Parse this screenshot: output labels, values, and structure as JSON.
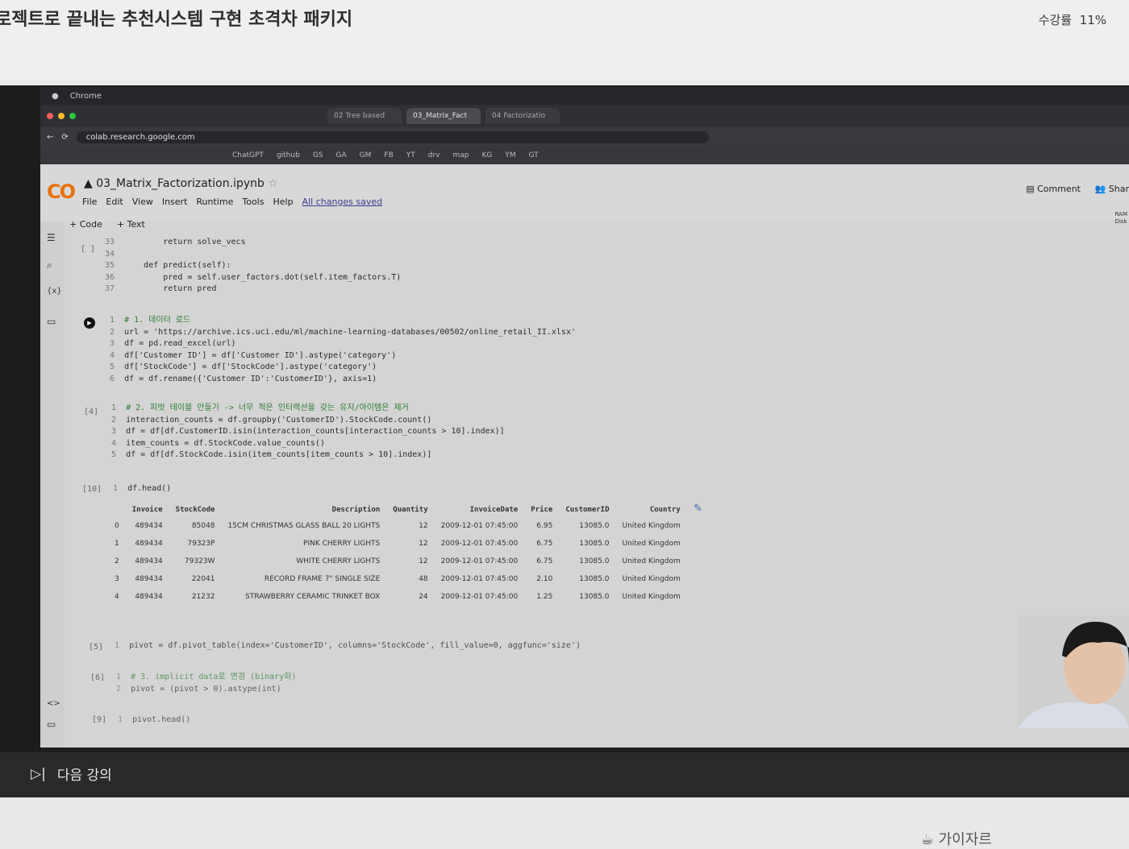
{
  "course": {
    "title": "로젝트로 끝내는 추천시스템 구현 초격차 패키지",
    "progress_label": "수강률",
    "progress_value": "11%"
  },
  "browser": {
    "app_name": "Chrome",
    "tabs": [
      "03_Matrix_Fact",
      "02 Tree based",
      "04 Factorizatio"
    ],
    "url": "colab.research.google.com",
    "bookmarks": [
      "ChatGPT",
      "github",
      "GS",
      "GA",
      "GM",
      "FB",
      "YT",
      "drv",
      "map",
      "KG",
      "YM",
      "GT"
    ]
  },
  "colab": {
    "logo": "CO",
    "notebook_title": "03_Matrix_Factorization.ipynb",
    "menu": [
      "File",
      "Edit",
      "View",
      "Insert",
      "Runtime",
      "Tools",
      "Help"
    ],
    "saved_status": "All changes saved",
    "comment_label": "Comment",
    "share_label": "Shar",
    "add_code": "+ Code",
    "add_text": "+ Text",
    "ram_label": "RAM",
    "disk_label": "Disk"
  },
  "cells": {
    "c0": {
      "exec": "[ ]",
      "lines": [
        {
          "n": "33",
          "code": "        return solve_vecs"
        },
        {
          "n": "34",
          "code": ""
        },
        {
          "n": "35",
          "code": "    def predict(self):"
        },
        {
          "n": "36",
          "code": "        pred = self.user_factors.dot(self.item_factors.T)"
        },
        {
          "n": "37",
          "code": "        return pred"
        }
      ]
    },
    "c1": {
      "lines": [
        {
          "n": "1",
          "code": "# 1. 데이터 로드"
        },
        {
          "n": "2",
          "code": "url = 'https://archive.ics.uci.edu/ml/machine-learning-databases/00502/online_retail_II.xlsx'"
        },
        {
          "n": "3",
          "code": "df = pd.read_excel(url)"
        },
        {
          "n": "4",
          "code": "df['Customer ID'] = df['Customer ID'].astype('category')"
        },
        {
          "n": "5",
          "code": "df['StockCode'] = df['StockCode'].astype('category')"
        },
        {
          "n": "6",
          "code": "df = df.rename({'Customer ID':'CustomerID'}, axis=1)"
        }
      ]
    },
    "c2": {
      "exec": "[4]",
      "lines": [
        {
          "n": "1",
          "code": "# 2. 피벗 테이블 만들기 -> 너무 적은 인터랙션을 갖는 유저/아이템은 제거"
        },
        {
          "n": "2",
          "code": "interaction_counts = df.groupby('CustomerID').StockCode.count()"
        },
        {
          "n": "3",
          "code": "df = df[df.CustomerID.isin(interaction_counts[interaction_counts > 10].index)]"
        },
        {
          "n": "4",
          "code": "item_counts = df.StockCode.value_counts()"
        },
        {
          "n": "5",
          "code": "df = df[df.StockCode.isin(item_counts[item_counts > 10].index)]"
        }
      ]
    },
    "c3": {
      "exec": "[10]",
      "lines": [
        {
          "n": "1",
          "code": "df.head()"
        }
      ]
    },
    "c4": {
      "exec": "[5]",
      "lines": [
        {
          "n": "1",
          "code": "pivot = df.pivot_table(index='CustomerID', columns='StockCode', fill_value=0, aggfunc='size')"
        }
      ]
    },
    "c5": {
      "exec": "[6]",
      "lines": [
        {
          "n": "1",
          "code": "# 3. implicit data로 변경 (binary화)"
        },
        {
          "n": "2",
          "code": "pivot = (pivot > 0).astype(int)"
        }
      ]
    },
    "c6": {
      "exec": "[9]",
      "lines": [
        {
          "n": "1",
          "code": "pivot.head()"
        }
      ]
    }
  },
  "dataframe": {
    "columns": [
      "",
      "Invoice",
      "StockCode",
      "Description",
      "Quantity",
      "InvoiceDate",
      "Price",
      "CustomerID",
      "Country"
    ],
    "rows": [
      [
        "0",
        "489434",
        "85048",
        "15CM CHRISTMAS GLASS BALL 20 LIGHTS",
        "12",
        "2009-12-01 07:45:00",
        "6.95",
        "13085.0",
        "United Kingdom"
      ],
      [
        "1",
        "489434",
        "79323P",
        "PINK CHERRY LIGHTS",
        "12",
        "2009-12-01 07:45:00",
        "6.75",
        "13085.0",
        "United Kingdom"
      ],
      [
        "2",
        "489434",
        "79323W",
        "WHITE CHERRY LIGHTS",
        "12",
        "2009-12-01 07:45:00",
        "6.75",
        "13085.0",
        "United Kingdom"
      ],
      [
        "3",
        "489434",
        "22041",
        "RECORD FRAME 7\" SINGLE SIZE",
        "48",
        "2009-12-01 07:45:00",
        "2.10",
        "13085.0",
        "United Kingdom"
      ],
      [
        "4",
        "489434",
        "21232",
        "STRAWBERRY CERAMIC TRINKET BOX",
        "24",
        "2009-12-01 07:45:00",
        "1.25",
        "13085.0",
        "United Kingdom"
      ]
    ]
  },
  "footer": {
    "next_lecture": "다음 강의",
    "bottom_right": "가이자르"
  }
}
